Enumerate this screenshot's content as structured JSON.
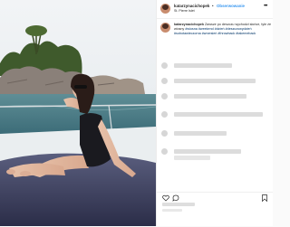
{
  "post": {
    "username": "katarzynacichopek",
    "separator": "•",
    "follow_label": "Obserwowanie",
    "location": "St. Pierre Islet"
  },
  "caption": {
    "username": "katarzynacichopek",
    "text": "Zawsze po deszczu wychodzi słońce, tyle że wiosny",
    "hashtags": "#wiosna #weekend #dzień #deszczowydzień #sobotawieczorna #wrzesień #throwback #takemeback"
  },
  "comments": {
    "count": 6
  },
  "colors": {
    "link": "#3897f0",
    "text": "#262626",
    "hashtag": "#003569"
  }
}
